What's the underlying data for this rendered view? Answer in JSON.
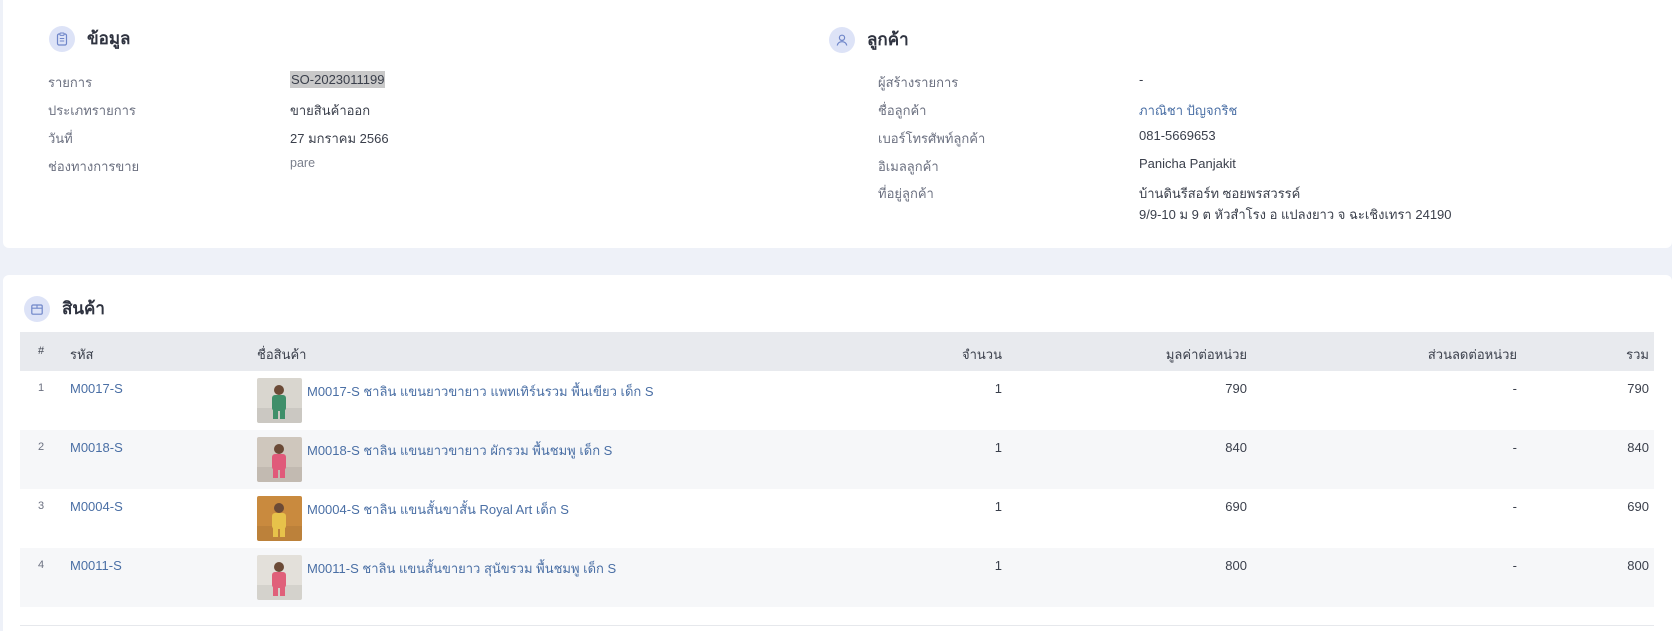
{
  "info": {
    "title": "ข้อมูล",
    "icon": "clipboard-icon",
    "fields": [
      {
        "label": "รายการ",
        "value": "SO-2023011199"
      },
      {
        "label": "ประเภทรายการ",
        "value": "ขายสินค้าออก"
      },
      {
        "label": "วันที่",
        "value": "27 มกราคม 2566"
      },
      {
        "label": "ช่องทางการขาย",
        "value": "pare"
      }
    ]
  },
  "customer": {
    "title": "ลูกค้า",
    "icon": "user-icon",
    "fields": [
      {
        "label": "ผู้สร้างรายการ",
        "value": "-"
      },
      {
        "label": "ชื่อลูกค้า",
        "value": "ภาณิชา ปัญจกริช"
      },
      {
        "label": "เบอร์โทรศัพท์ลูกค้า",
        "value": "081-5669653"
      },
      {
        "label": "อิเมลลูกค้า",
        "value": "Panicha Panjakit"
      },
      {
        "label": "ที่อยู่ลูกค้า",
        "value_line1": "บ้านดินรีสอร์ท ซอยพรสวรรค์",
        "value_line2": "9/9-10 ม 9 ต หัวสำโรง อ แปลงยาว จ ฉะเชิงเทรา 24190"
      }
    ]
  },
  "products": {
    "title": "สินค้า",
    "icon": "box-icon",
    "columns": {
      "index": "#",
      "code": "รหัส",
      "name": "ชื่อสินค้า",
      "qty": "จำนวน",
      "unit_price": "มูลค่าต่อหน่วย",
      "unit_discount": "ส่วนลดต่อหน่วย",
      "total": "รวม"
    },
    "rows": [
      {
        "index": "1",
        "code": "M0017-S",
        "name": "M0017-S ชาลิน แขนยาวขายาว แพทเทิร์นรวม พื้นเขียว เด็ก S",
        "qty": "1",
        "unit_price": "790",
        "unit_discount": "-",
        "total": "790",
        "thumb_color": "#d9d6cf",
        "accent": "#3f8f6a"
      },
      {
        "index": "2",
        "code": "M0018-S",
        "name": "M0018-S ชาลิน แขนยาวขายาว ผักรวม พื้นชมพู เด็ก S",
        "qty": "1",
        "unit_price": "840",
        "unit_discount": "-",
        "total": "840",
        "thumb_color": "#cfc7bd",
        "accent": "#e05a7a"
      },
      {
        "index": "3",
        "code": "M0004-S",
        "name": "M0004-S ชาลิน แขนสั้นขาสั้น Royal Art เด็ก S",
        "qty": "1",
        "unit_price": "690",
        "unit_discount": "-",
        "total": "690",
        "thumb_color": "#c98a3e",
        "accent": "#e7c24a"
      },
      {
        "index": "4",
        "code": "M0011-S",
        "name": "M0011-S ชาลิน แขนสั้นขายาว สุนัขรวม พื้นชมพู เด็ก S",
        "qty": "1",
        "unit_price": "800",
        "unit_discount": "-",
        "total": "800",
        "thumb_color": "#e3e0da",
        "accent": "#e0607a"
      }
    ]
  }
}
